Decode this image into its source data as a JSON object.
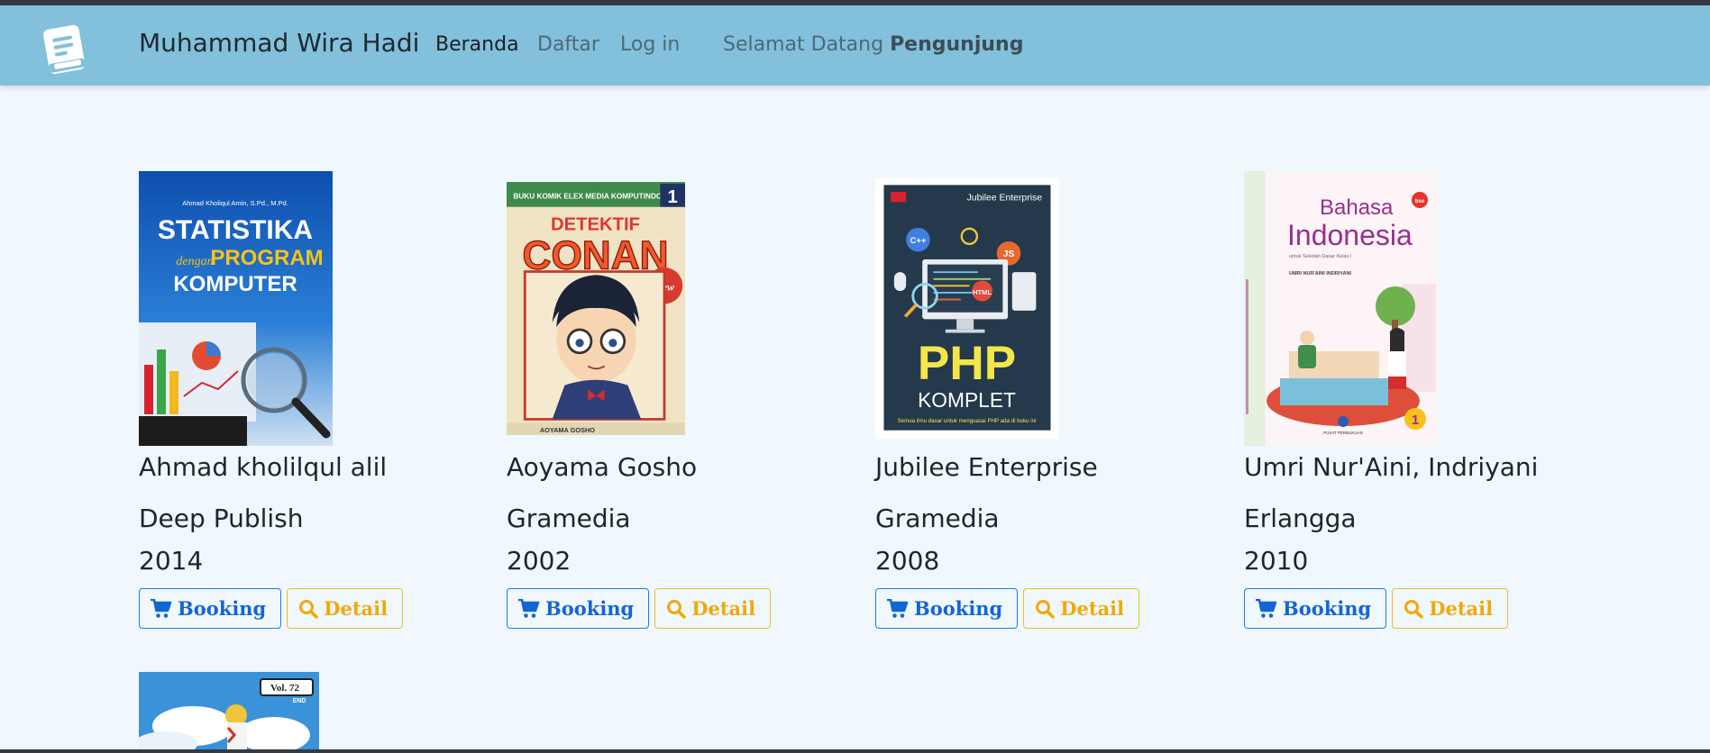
{
  "navbar": {
    "brand": "Muhammad Wira Hadi",
    "links": [
      "Beranda",
      "Daftar",
      "Log in"
    ],
    "welcome_prefix": "Selamat Datang",
    "welcome_user": "Pengunjung"
  },
  "colors": {
    "navbar_bg": "#82c0dc",
    "page_bg": "#f0f8fd",
    "booking": "#1266d4",
    "detail": "#f2a80a"
  },
  "icons": {
    "logo": "book-icon",
    "booking": "cart-icon",
    "detail": "search-icon"
  },
  "books": [
    {
      "cover": {
        "author_line": "Ahmad Kholiqul Amin, S.Pd., M.Pd.",
        "title_lines": [
          "STATISTIKA",
          "dengan",
          "PROGRAM",
          "KOMPUTER"
        ]
      },
      "author": "Ahmad kholilqul alil",
      "publisher": "Deep Publish",
      "year": "2014",
      "booking_label": "Booking",
      "detail_label": "Detail"
    },
    {
      "cover": {
        "series": "BUKU KOMIK ELEX MEDIA KOMPUTINDO",
        "volume": "1",
        "title_lines": [
          "DETEKTIF",
          "CONAN"
        ],
        "badge": "New",
        "footer": "AOYAMA GOSHO"
      },
      "author": "Aoyama Gosho",
      "publisher": "Gramedia",
      "year": "2002",
      "booking_label": "Booking",
      "detail_label": "Detail"
    },
    {
      "cover": {
        "publisher": "Jubilee Enterprise",
        "tags": [
          "C++",
          "JS",
          "HTML"
        ],
        "title_lines": [
          "PHP",
          "KOMPLET"
        ],
        "tagline": "Semua ilmu dasar untuk menguasai PHP ada di buku ini"
      },
      "author": "Jubilee Enterprise",
      "publisher": "Gramedia",
      "year": "2008",
      "booking_label": "Booking",
      "detail_label": "Detail"
    },
    {
      "cover": {
        "title_lines": [
          "Bahasa",
          "Indonesia"
        ],
        "subtitle": "untuk Sekolah Dasar Kelas I",
        "authors_line": "UMRI NUR'AINI INDRIYANI",
        "grade": "1",
        "footer": "PUSAT PERBUKUAN",
        "badge": "bse"
      },
      "author": "Umri Nur'Aini, Indriyani",
      "publisher": "Erlangga",
      "year": "2010",
      "booking_label": "Booking",
      "detail_label": "Detail"
    }
  ],
  "partial_book": {
    "volume": "Vol. 72",
    "end_label": "END"
  }
}
